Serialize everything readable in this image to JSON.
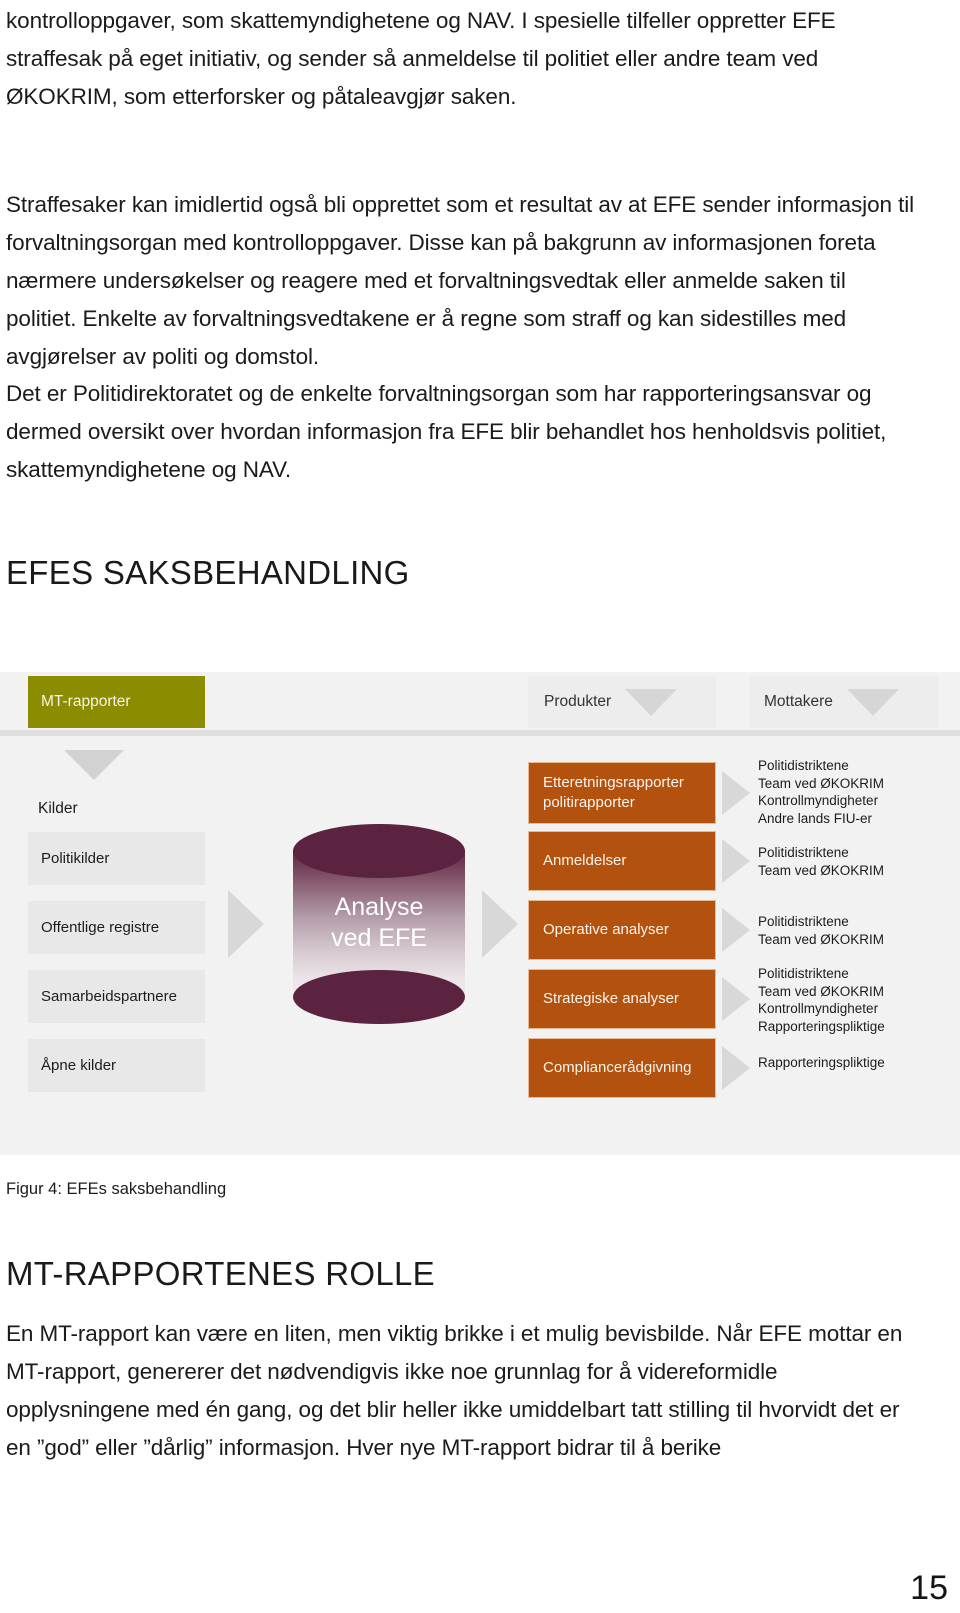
{
  "document": {
    "page_number": "15",
    "paragraphs_top": [
      "kontrolloppgaver, som skattemyndighetene og NAV. I spesielle tilfeller oppretter EFE straffesak på eget initiativ, og sender så anmeldelse til politiet eller andre team ved ØKOKRIM, som etterforsker og påtaleavgjør saken."
    ],
    "paragraphs_mid": [
      "Straffesaker kan imidlertid også bli opprettet som et resultat av at EFE sender informasjon til forvaltningsorgan med kontrolloppgaver. Disse kan på bakgrunn av informasjonen foreta nærmere undersøkelser og reagere med et forvaltningsvedtak eller anmelde saken til politiet. Enkelte av forvaltningsvedtakene er å regne som straff og kan sidestilles med avgjørelser av politi og domstol.",
      "Det er Politidirektoratet og de enkelte forvaltningsorgan som har rapporteringsansvar og dermed oversikt over hvordan informasjon fra EFE blir behandlet hos henholdsvis politiet, skattemyndighetene og NAV."
    ],
    "heading_efes": "EFES SAKSBEHANDLING",
    "heading_mtr": "MT-RAPPORTENES ROLLE",
    "paragraphs_bottom": [
      "En MT-rapport kan være en liten, men viktig brikke i et mulig bevisbilde. Når EFE mottar en MT-rapport, genererer det nødvendigvis ikke noe grunnlag for å videreformidle opplysningene med én gang, og det blir heller ikke umiddelbart tatt stilling til hvorvidt det er en ”god” eller ”dårlig” informasjon. Hver nye MT-rapport bidrar til å berike"
    ]
  },
  "figure": {
    "caption": "Figur 4: EFEs saksbehandling",
    "colors": {
      "olive": "#8c8c00",
      "orange": "#b3510f",
      "maroon": "#5c2340",
      "grey_arrow": "#d8d8d8",
      "panel_bg": "#f2f2f2",
      "box_bg": "#e8e8e8"
    },
    "columns": {
      "sources_header": "MT-rapporter",
      "products_header": "Produkter",
      "receivers_header": "Mottakere"
    },
    "sources_subtitle": "Kilder",
    "sources": [
      {
        "label": "Politikilder"
      },
      {
        "label": "Offentlige registre"
      },
      {
        "label": "Samarbeidspartnere"
      },
      {
        "label": "Åpne kilder"
      }
    ],
    "analysis": {
      "line1": "Analyse",
      "line2": "ved EFE"
    },
    "rows": [
      {
        "product": "Etteretningsrapporter\npolitirapporter",
        "product_lines": [
          "Etteretningsrapporter",
          "politirapporter"
        ],
        "receivers": [
          "Politidistriktene",
          "Team ved ØKOKRIM",
          "Kontrollmyndigheter",
          "Andre lands FIU-er"
        ]
      },
      {
        "product": "Anmeldelser",
        "product_lines": [
          "Anmeldelser"
        ],
        "receivers": [
          "Politidistriktene",
          "Team ved ØKOKRIM"
        ]
      },
      {
        "product": "Operative analyser",
        "product_lines": [
          "Operative analyser"
        ],
        "receivers": [
          "Politidistriktene",
          "Team ved ØKOKRIM"
        ]
      },
      {
        "product": "Strategiske analyser",
        "product_lines": [
          "Strategiske analyser"
        ],
        "receivers": [
          "Politidistriktene",
          "Team ved ØKOKRIM",
          "Kontrollmyndigheter",
          "Rapporteringspliktige"
        ]
      },
      {
        "product": "Compliancerådgivning",
        "product_lines": [
          "Compliancerådgivning"
        ],
        "receivers": [
          "Rapporteringspliktige"
        ]
      }
    ]
  }
}
